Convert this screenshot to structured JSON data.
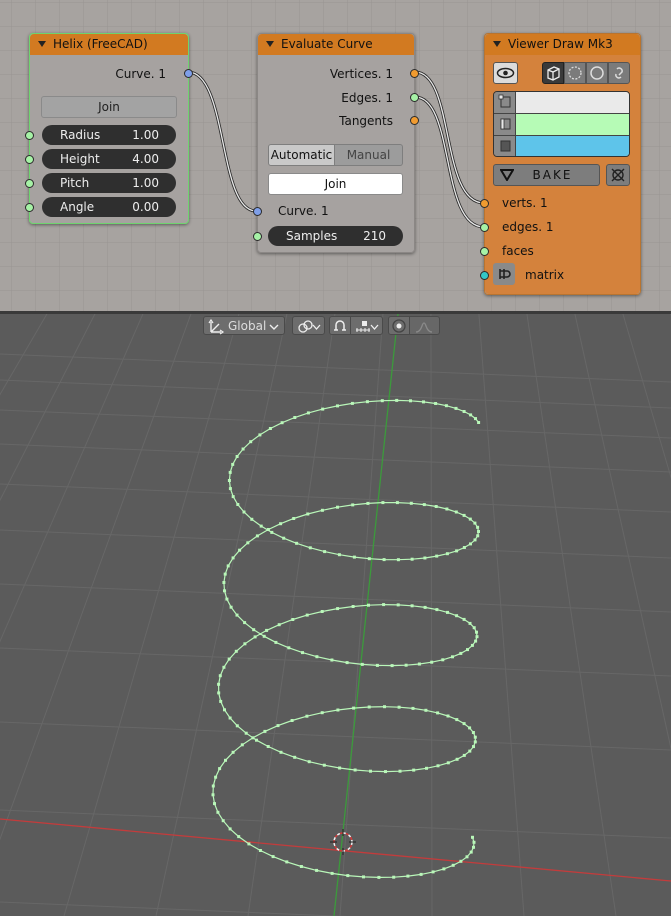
{
  "nodes": {
    "helix": {
      "title": "Helix (FreeCAD)",
      "output": "Curve. 1",
      "join_label": "Join",
      "params": [
        {
          "label": "Radius",
          "value": "1.00"
        },
        {
          "label": "Height",
          "value": "4.00"
        },
        {
          "label": "Pitch",
          "value": "1.00"
        },
        {
          "label": "Angle",
          "value": "0.00"
        }
      ]
    },
    "evaluate": {
      "title": "Evaluate Curve",
      "outputs": [
        "Vertices. 1",
        "Edges. 1",
        "Tangents"
      ],
      "mode_automatic": "Automatic",
      "mode_manual": "Manual",
      "join_label": "Join",
      "input": "Curve. 1",
      "samples_label": "Samples",
      "samples_value": "210"
    },
    "viewer": {
      "title": "Viewer Draw Mk3",
      "bake_label": "BAKE",
      "inputs": [
        "verts. 1",
        "edges. 1",
        "faces",
        "matrix"
      ],
      "colors": {
        "verts": "#eaeaea",
        "edges": "#b6fbb6",
        "faces": "#5ec4ea"
      }
    }
  },
  "viewport": {
    "orientation": "Global",
    "icons": [
      "eye-icon",
      "cube-icon",
      "sphere-icon",
      "link-icon",
      "snap-icon",
      "proportional-icon"
    ]
  },
  "colors": {
    "node_header": "#d27a21",
    "editor_bg": "#a7a3a0",
    "viewport_bg": "#5b5b5b",
    "curve": "#b9f7b9",
    "x_axis": "#c33c3c",
    "y_axis": "#3c9a3c"
  }
}
